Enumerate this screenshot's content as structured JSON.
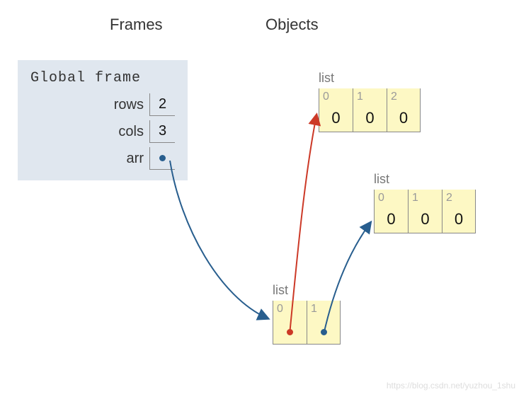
{
  "headings": {
    "frames": "Frames",
    "objects": "Objects"
  },
  "global_frame": {
    "title": "Global frame",
    "vars": {
      "rows": {
        "name": "rows",
        "value": "2"
      },
      "cols": {
        "name": "cols",
        "value": "3"
      },
      "arr": {
        "name": "arr",
        "value": ""
      }
    }
  },
  "lists": {
    "top": {
      "label": "list",
      "cells": [
        {
          "index": "0",
          "value": "0"
        },
        {
          "index": "1",
          "value": "0"
        },
        {
          "index": "2",
          "value": "0"
        }
      ]
    },
    "middle": {
      "label": "list",
      "cells": [
        {
          "index": "0",
          "value": "0"
        },
        {
          "index": "1",
          "value": "0"
        },
        {
          "index": "2",
          "value": "0"
        }
      ]
    },
    "bottom": {
      "label": "list",
      "cells": [
        {
          "index": "0",
          "value": ""
        },
        {
          "index": "1",
          "value": ""
        }
      ]
    }
  },
  "watermark": "https://blog.csdn.net/yuzhou_1shu"
}
